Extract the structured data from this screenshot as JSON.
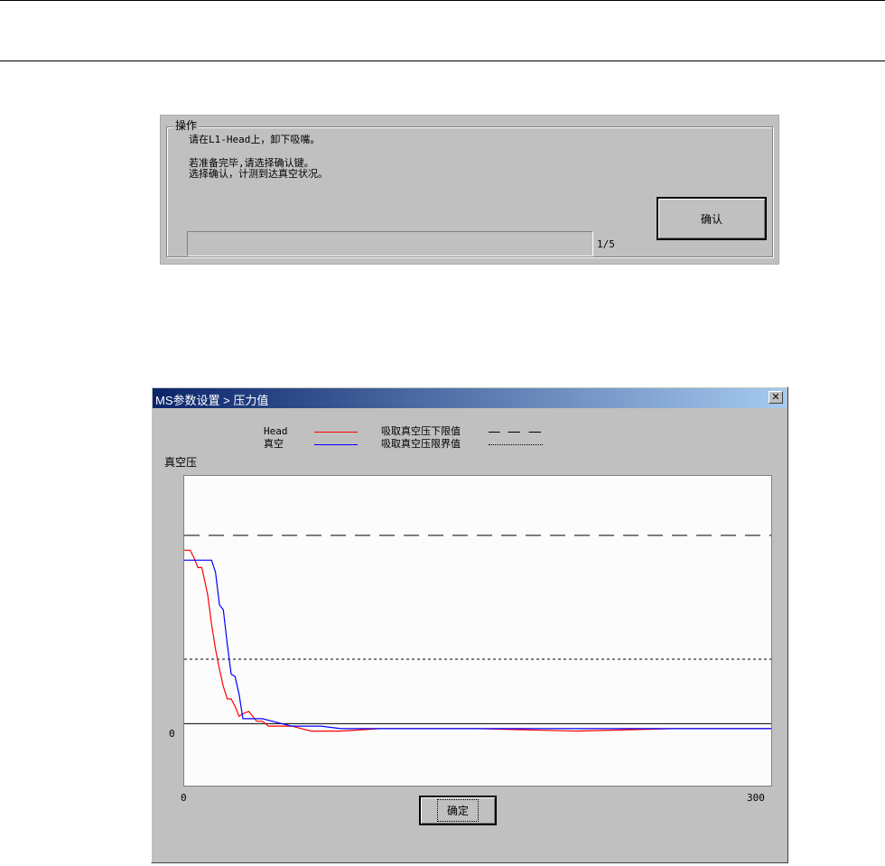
{
  "operation": {
    "legend": "操作",
    "lines": [
      "请在L1-Head上，卸下吸嘴。",
      "",
      "若准备完毕,请选择确认键。",
      "选择确认，计测到达真空状况。"
    ],
    "progress_fraction": 0.0,
    "count": "1/5",
    "confirm_label": "确认"
  },
  "dialog": {
    "title": "MS参数设置 > 压力值",
    "close_glyph": "✕",
    "legend": {
      "series1": "Head",
      "series2": "真空",
      "threshold1": "吸取真空压下限值",
      "threshold2": "吸取真空压限界值"
    },
    "y_axis_label": "真空压",
    "y_zero_tick": "0",
    "x_ticks": [
      "0",
      "300"
    ],
    "ok_label": "确定"
  },
  "chart_data": {
    "type": "line",
    "xlim": [
      0,
      300
    ],
    "ylim": [
      -25,
      100
    ],
    "colors": {
      "head": "#ff0000",
      "vacuum": "#0000ff",
      "thresholds": "#000000",
      "zero": "#000000"
    },
    "thresholds": [
      {
        "value": 76,
        "style": "long-dash"
      },
      {
        "value": 26,
        "style": "short-dash"
      }
    ],
    "series": [
      {
        "name": "Head",
        "x": [
          0,
          3,
          5,
          7,
          9,
          12,
          14,
          16,
          18,
          20,
          22,
          24,
          26,
          28,
          30,
          33,
          35,
          37,
          40,
          43,
          46,
          50,
          55,
          60,
          65,
          70,
          80,
          100,
          150,
          200,
          250,
          300
        ],
        "y": [
          70,
          70,
          67,
          63,
          63,
          52,
          40,
          30,
          22,
          15,
          10,
          10,
          7,
          3,
          4,
          5,
          3,
          1,
          1,
          -1,
          -1,
          -1,
          -1,
          -2,
          -3,
          -3,
          -3,
          -2,
          -2,
          -3,
          -2,
          -2
        ]
      },
      {
        "name": "真空",
        "x": [
          0,
          3,
          8,
          14,
          16,
          18,
          20,
          22,
          24,
          26,
          28,
          30,
          31,
          35,
          40,
          45,
          50,
          55,
          60,
          70,
          80,
          100,
          150,
          200,
          250,
          300
        ],
        "y": [
          66,
          66,
          66,
          66,
          61,
          48,
          46,
          32,
          20,
          19,
          12,
          2,
          2,
          2,
          2,
          1,
          0,
          -1,
          -1,
          -1,
          -2,
          -2,
          -2,
          -2,
          -2,
          -2
        ]
      }
    ]
  }
}
